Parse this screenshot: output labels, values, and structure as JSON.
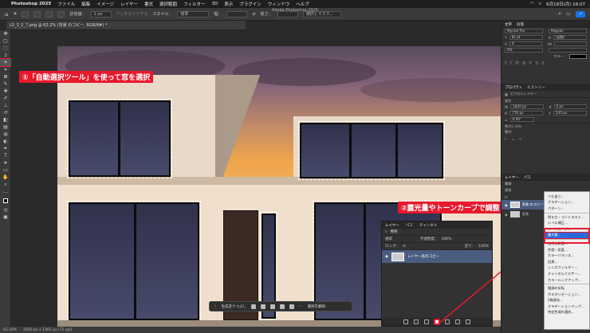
{
  "menubar": {
    "app": "Photoshop 2025",
    "items": [
      "ファイル",
      "編集",
      "イメージ",
      "レイヤー",
      "書式",
      "選択範囲",
      "フィルター",
      "3D",
      "表示",
      "プラグイン",
      "ウィンドウ",
      "ヘルプ"
    ],
    "clock": "6月18日(月) 16:07"
  },
  "window_title": "Adobe Photoshop 2025",
  "options": {
    "tolerance_label": "許容値：",
    "tolerance_value": "1 px",
    "antialias": "アンチエイリアス",
    "style_label": "スタイル：",
    "style_value": "標準",
    "width_label": "幅：",
    "height_label": "高さ：",
    "select_mask": "選択とマスク..."
  },
  "document": {
    "tab": "LS_3_2_7.png @ 62.2% (背景 のコピー, RGB/8#) *"
  },
  "status": {
    "zoom": "62.19%",
    "size": "1820 px x 1365 px (72 ppi)"
  },
  "annotations": {
    "step1": "①「自動選択ツール」を使って窓を選択",
    "step2": "②露光量やトーンカーブで調整"
  },
  "taskbar": {
    "label": "生成塗りつぶし",
    "right": "選択を解除"
  },
  "layers": {
    "tabs": [
      "レイヤー",
      "パス",
      "チャンネル"
    ],
    "kind": "種類",
    "blend": "通常",
    "opacity_label": "不透明度：",
    "opacity": "100%",
    "fill_label": "塗り：",
    "fill": "100%",
    "lock_label": "ロック：",
    "layer_name": "レイヤー名のコピー"
  },
  "right_panel": {
    "tabs_top": [
      "文字",
      "段落"
    ],
    "font": "Myriad Pro",
    "font_style": "Regular",
    "size": "81 pt",
    "leading": "(自動)",
    "tracking": "0",
    "scale": "0%",
    "color_label": "カラー：",
    "tabs_mid": [
      "プロパティ",
      "ヒストリー"
    ],
    "pixel_layer": "ピクセルレイヤー",
    "transform": "属性",
    "w": "1820 px",
    "h": "770 px",
    "x": "0 px",
    "y": "235 px",
    "angle": "0.00°",
    "align": "整列と分布",
    "align2": "整列",
    "tabs_bottom": [
      "レイヤー",
      "パス"
    ],
    "kind": "種類",
    "blend": "通常",
    "layer_copy": "背景 のコピー",
    "layer_bg": "背景"
  },
  "adjust_menu": {
    "items": [
      "べた塗り...",
      "グラデーション...",
      "パターン...",
      "明るさ・コントラスト...",
      "レベル補正...",
      "トーンカーブ...",
      "露光量...",
      "自然な彩度...",
      "色相・彩度...",
      "カラーバランス...",
      "白黒...",
      "レンズフィルター...",
      "チャンネルミキサー...",
      "カラールックアップ...",
      "階調の反転",
      "ポスタリゼーション...",
      "2階調化...",
      "グラデーションマップ...",
      "特定色域の選択..."
    ],
    "highlight": "露光量..."
  }
}
